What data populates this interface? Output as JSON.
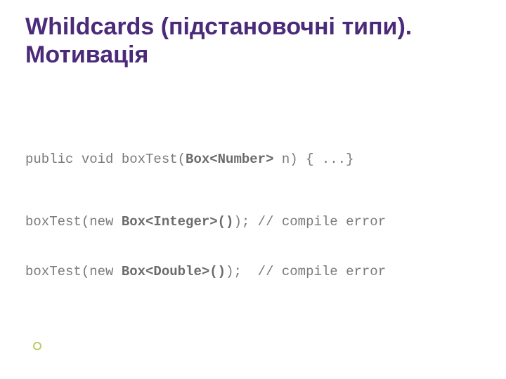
{
  "title": "Whildcards (підстановочні типи). Мотивація",
  "code": {
    "line1": {
      "a": "public void boxTest(",
      "b": "Box<Number>",
      "c": " n) { ...}"
    },
    "line2": {
      "a": "boxTest(new ",
      "b": "Box<Integer>()",
      "c": "); // compile error"
    },
    "line3": {
      "a": "boxTest(new ",
      "b": "Box<Double>()",
      "c": ");  // compile error"
    }
  }
}
